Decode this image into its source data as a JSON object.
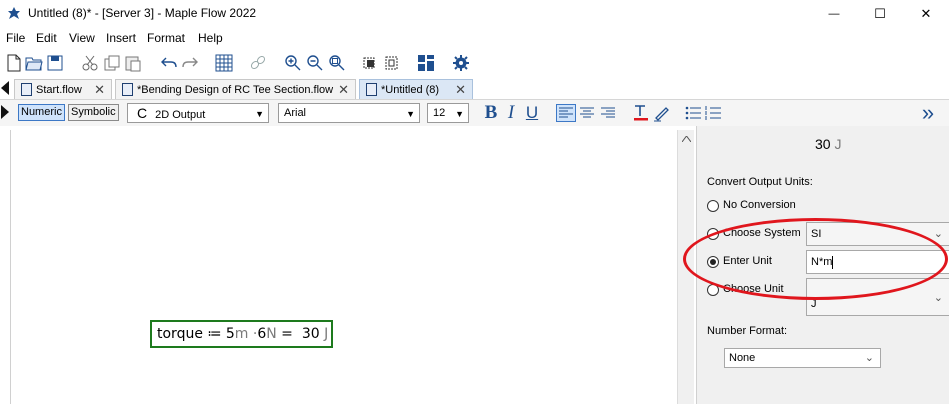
{
  "window": {
    "title": "Untitled (8)* - [Server 3] - Maple Flow 2022",
    "minimize_symbol": "—",
    "maximize_symbol": "☐",
    "close_symbol": "✕"
  },
  "menu": [
    "File",
    "Edit",
    "View",
    "Insert",
    "Format",
    "Help"
  ],
  "toolbar_icons": [
    "new-document",
    "open",
    "save",
    "cut",
    "copy",
    "paste",
    "undo",
    "redo",
    "grid",
    "link",
    "zoom-in",
    "zoom-out",
    "zoom-fit",
    "copy-image",
    "paste-image",
    "layout",
    "settings"
  ],
  "tabs": [
    {
      "label": "Start.flow",
      "close": "✕",
      "active": false
    },
    {
      "label": "*Bending Design of RC Tee Section.flow",
      "close": "✕",
      "active": false
    },
    {
      "label": "*Untitled (8)",
      "close": "✕",
      "active": true
    }
  ],
  "format_bar": {
    "numeric_label": "Numeric",
    "symbolic_label": "Symbolic",
    "output_mode_prefix": "C",
    "output_mode": "2D Output",
    "font": "Arial",
    "font_size": "12",
    "bold": "B",
    "italic": "I",
    "underline": "U",
    "collapse": "»"
  },
  "canvas": {
    "math_lhs": "torque",
    "assign": "≔",
    "math_expr_a": "5",
    "unit_m": "m",
    "dot": "·",
    "math_expr_b": "6",
    "unit_N": "N",
    "equals": "=",
    "result_value": "30",
    "result_unit": "J"
  },
  "panel": {
    "result_value": "30",
    "result_unit": "J",
    "convert_heading": "Convert Output Units:",
    "options": [
      {
        "label": "No Conversion",
        "selected": false
      },
      {
        "label": "Choose System",
        "selected": false
      },
      {
        "label": "Enter Unit",
        "selected": true
      },
      {
        "label": "Choose Unit",
        "selected": false
      }
    ],
    "system_value": "SI",
    "enter_unit_value": "N*m",
    "choose_unit_value": "J",
    "number_format_heading": "Number Format:",
    "number_format_value": "None"
  },
  "colors": {
    "math_box_border": "#1d7a1d",
    "annotation_ellipse": "#e0161d",
    "icon_blue": "#1f4f8f"
  }
}
